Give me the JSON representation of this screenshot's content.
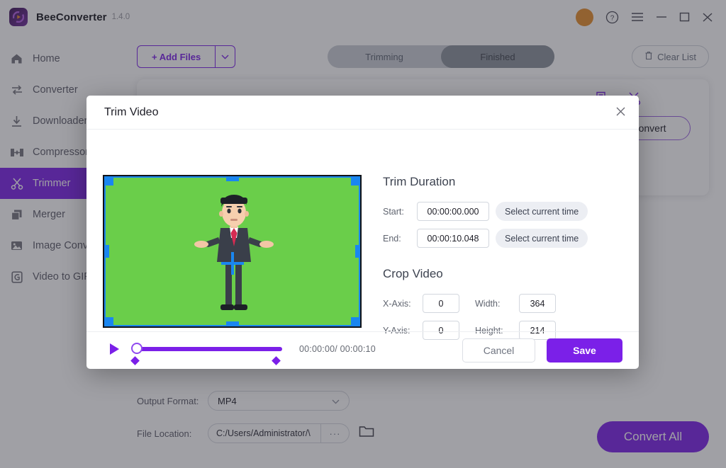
{
  "titlebar": {
    "app_name": "BeeConverter",
    "version": "1.4.0",
    "icons": {
      "avatar": "user-avatar",
      "help": "help-circle-icon",
      "menu": "hamburger-menu-icon",
      "minimize": "minimize-icon",
      "maximize": "maximize-icon",
      "close": "close-icon"
    }
  },
  "sidebar": {
    "items": [
      {
        "label": "Home",
        "icon": "home-icon",
        "active": false
      },
      {
        "label": "Converter",
        "icon": "convert-arrows-icon",
        "active": false
      },
      {
        "label": "Downloader",
        "icon": "download-icon",
        "active": false
      },
      {
        "label": "Compressor",
        "icon": "compress-icon",
        "active": false
      },
      {
        "label": "Trimmer",
        "icon": "scissors-icon",
        "active": true
      },
      {
        "label": "Merger",
        "icon": "layers-icon",
        "active": false
      },
      {
        "label": "Image Converter",
        "icon": "image-icon",
        "active": false
      },
      {
        "label": "Video to GIF",
        "icon": "gif-icon",
        "active": false
      }
    ]
  },
  "toolbar": {
    "add_files_label": "+ Add Files",
    "add_files_caret": "chevron-down-icon",
    "tabs": [
      {
        "label": "Trimming",
        "active": false
      },
      {
        "label": "Finished",
        "active": true
      }
    ],
    "clear_list_label": "Clear List",
    "clear_list_icon": "trash-icon"
  },
  "file_card": {
    "convert_label": "Convert",
    "icons": [
      "settings-list-icon",
      "scissors-icon"
    ]
  },
  "bottom": {
    "output_format_label": "Output Format:",
    "output_format_value": "MP4",
    "file_location_label": "File Location:",
    "file_location_value": "C:/Users/Administrator/\\",
    "browse_dots": "···",
    "folder_icon": "folder-icon",
    "convert_all_label": "Convert All"
  },
  "modal": {
    "title": "Trim Video",
    "close_icon": "close-icon",
    "player": {
      "play_icon": "play-icon",
      "timecode": "00:00:00/ 00:00:10",
      "progress_percent": 0
    },
    "trim": {
      "section_title": "Trim Duration",
      "start_label": "Start:",
      "start_value": "00:00:00.000",
      "start_button": "Select current time",
      "end_label": "End:",
      "end_value": "00:00:10.048",
      "end_button": "Select current time"
    },
    "crop": {
      "section_title": "Crop Video",
      "x_label": "X-Axis:",
      "x_value": "0",
      "width_label": "Width:",
      "width_value": "364",
      "y_label": "Y-Axis:",
      "y_value": "0",
      "height_label": "Height:",
      "height_value": "214"
    },
    "footer": {
      "cancel_label": "Cancel",
      "save_label": "Save"
    }
  },
  "colors": {
    "accent_purple": "#7b20e8",
    "green_screen": "#6ace4a",
    "crop_blue": "#1a86f0",
    "avatar_orange": "#e58c2a"
  }
}
